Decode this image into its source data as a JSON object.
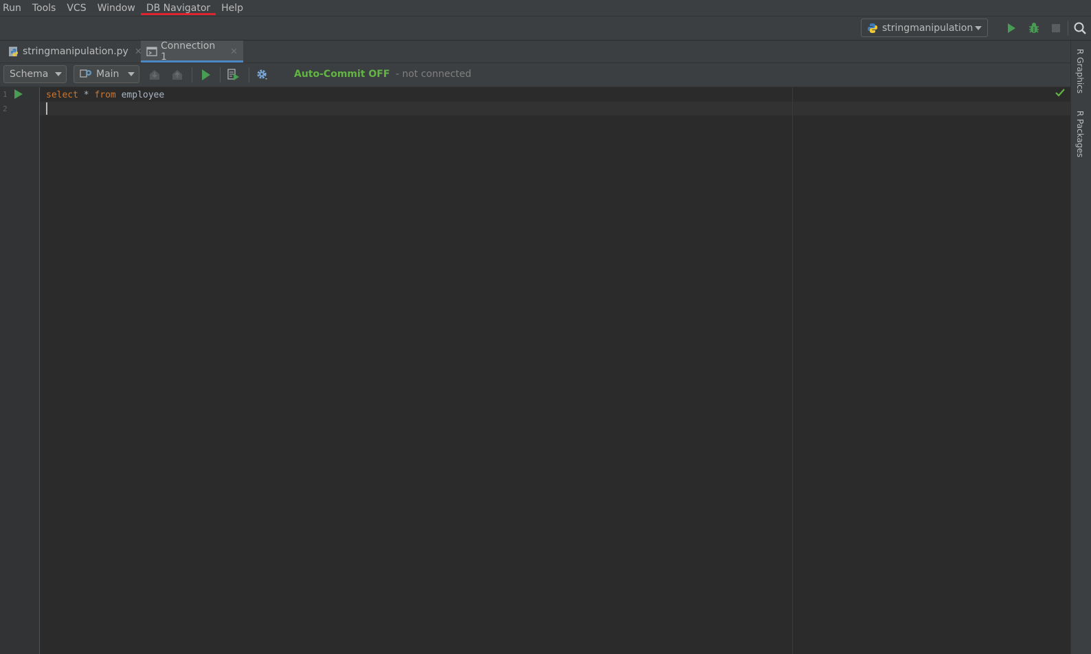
{
  "menu": {
    "items": [
      {
        "label": "Run"
      },
      {
        "label": "Tools"
      },
      {
        "label": "VCS"
      },
      {
        "label": "Window"
      },
      {
        "label": "DB Navigator",
        "active": true
      },
      {
        "label": "Help"
      }
    ]
  },
  "navbar": {
    "run_config": "stringmanipulation",
    "icons": [
      "run-icon",
      "debug-icon",
      "stop-icon",
      "search-icon"
    ]
  },
  "tabs": [
    {
      "label": "stringmanipulation.py",
      "icon": "python-file-icon",
      "selected": false
    },
    {
      "label": "Connection 1",
      "icon": "console-icon",
      "selected": true
    }
  ],
  "editor_toolbar": {
    "schema_combo": "Schema",
    "session_combo": "Main",
    "auto_commit": "Auto-Commit OFF",
    "connection_status": "- not connected"
  },
  "editor": {
    "lines": [
      "1",
      "2"
    ],
    "code": {
      "kw1": "select",
      "star": " * ",
      "kw2": "from",
      "ident": " employee"
    }
  },
  "right_strip": {
    "r_graphics": "R Graphics",
    "r_packages": "R Packages"
  },
  "colors": {
    "accent_green": "#62b543",
    "keyword_orange": "#cc7832",
    "menu_underline_red": "#e0242f",
    "tab_underline_blue": "#4a88c7"
  }
}
